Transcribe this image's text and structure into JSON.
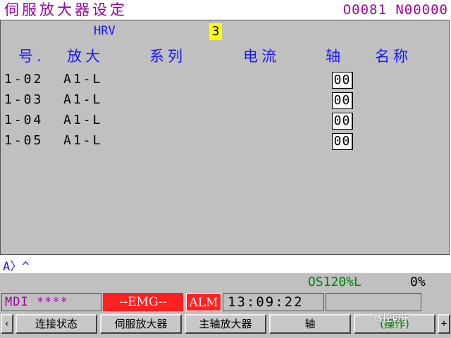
{
  "header": {
    "title": "伺服放大器设定",
    "program_number": "O0081 N00000"
  },
  "hrv": {
    "label": "HRV",
    "value": "3"
  },
  "table": {
    "columns": [
      "号.",
      "放大",
      "系列",
      "电流",
      "轴",
      "名称"
    ],
    "rows": [
      {
        "num": "1-02",
        "amp": "A1-L",
        "axis": "00"
      },
      {
        "num": "1-03",
        "amp": "A1-L",
        "axis": "00"
      },
      {
        "num": "1-04",
        "amp": "A1-L",
        "axis": "00"
      },
      {
        "num": "1-05",
        "amp": "A1-L",
        "axis": "00"
      }
    ]
  },
  "input_line": "A〉^",
  "status": {
    "override": "OS120%L",
    "percent": "0%",
    "mode": "MDI  ****",
    "emergency": "--EMG--",
    "alarm": "ALM",
    "time": "13:09:22"
  },
  "softkeys": {
    "left_arrow": "‹",
    "right_arrow": "+",
    "keys": [
      "连接状态",
      "伺服放大器",
      "主轴放大器",
      "轴",
      "(操作)"
    ]
  },
  "watermark": "数控可乐",
  "colors": {
    "title": "#a000a0",
    "header_text": "#1818ff",
    "panel": "#c0c0c0",
    "emg": "#ff2020",
    "hrv_highlight": "#ffff00"
  }
}
